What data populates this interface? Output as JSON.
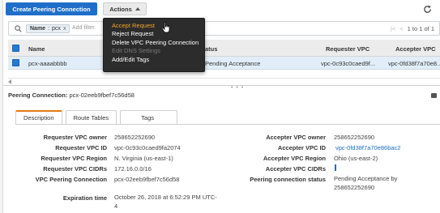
{
  "toolbar": {
    "create_label": "Create Peering Connection",
    "actions_label": "Actions"
  },
  "actions_menu": {
    "items": [
      {
        "label": "Accept Request",
        "state": "hover"
      },
      {
        "label": "Reject Request",
        "state": "normal"
      },
      {
        "label": "Delete VPC Peering Connection",
        "state": "normal"
      },
      {
        "label": "Edit DNS Settings",
        "state": "disabled"
      },
      {
        "label": "Add/Edit Tags",
        "state": "normal"
      }
    ]
  },
  "search": {
    "chip_key": "Name",
    "chip_value": "pcx",
    "chip_close": "x",
    "placeholder": "Add filter",
    "pager_text": "1 to 1 of 1"
  },
  "table": {
    "columns": [
      "Name",
      "Status",
      "Requester VPC",
      "Accepter VPC"
    ],
    "visible_headers": {
      "name": "Name",
      "status_partial": "atus",
      "requester": "Requester VPC",
      "accepter": "Accepter VPC"
    },
    "rows": [
      {
        "name": "pcx-aaaabbbb",
        "status": "Pending Acceptance",
        "requester_vpc": "vpc-0c93c0caed9f...",
        "accepter_vpc": "vpc-0fd38f7a70e8..."
      }
    ]
  },
  "details": {
    "title_label": "Peering Connection:",
    "title_value": "pcx-02eeb9fbef7c56d58",
    "tabs": [
      "Description",
      "Route Tables",
      "Tags"
    ],
    "active_tab": "Description",
    "left": [
      {
        "label": "Requester VPC owner",
        "value": "258652252690"
      },
      {
        "label": "Requester VPC ID",
        "value": "vpc-0c93c0caed9fa2074"
      },
      {
        "label": "Requester VPC Region",
        "value": "N. Virginia (us-east-1)"
      },
      {
        "label": "Requester VPC CIDRs",
        "value": "172.16.0.0/16"
      },
      {
        "label": "VPC Peering Connection",
        "value": "pcx-02eeb9fbef7c56d58"
      },
      {
        "label": "Expiration time",
        "value": "October 26, 2018 at 6:52:29 PM UTC-4"
      }
    ],
    "right": [
      {
        "label": "Accepter VPC owner",
        "value": "258652252690"
      },
      {
        "label": "Accepter VPC ID",
        "value": "vpc-0fd38f7a70e86bac2"
      },
      {
        "label": "Accepter VPC Region",
        "value": "Ohio (us-east-2)"
      },
      {
        "label": "Accepter VPC CIDRs",
        "value": ""
      },
      {
        "label": "Peering connection status",
        "value": "Pending Acceptance by 258652252690"
      }
    ]
  },
  "colors": {
    "primary_button": "#1f6fc9",
    "active_tab_accent": "#e47911",
    "menu_background": "#2c2c2c",
    "menu_hover_text": "#f5a524",
    "link": "#1a6dc2",
    "selected_row": "#e1eef9"
  },
  "icons": [
    "refresh-icon",
    "search-icon",
    "checkbox-icon",
    "pointer-cursor-icon",
    "collapse-panel-icon"
  ]
}
